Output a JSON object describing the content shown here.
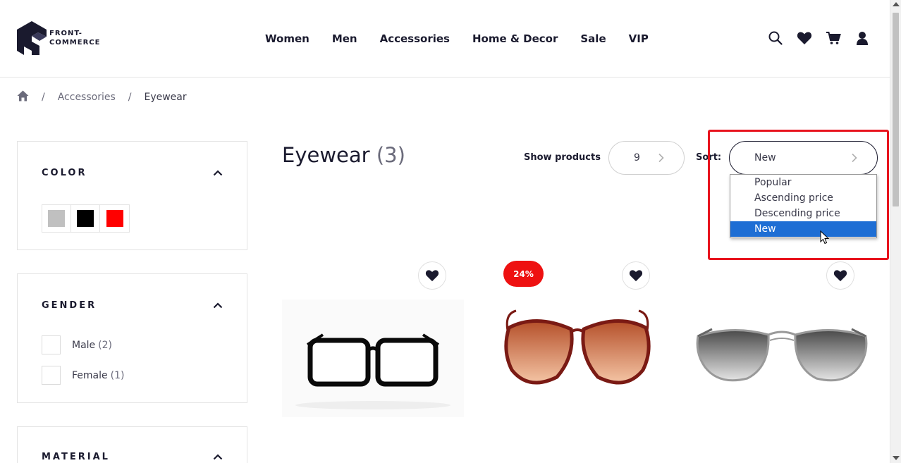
{
  "brand": {
    "line1": "FRONT-",
    "line2": "COMMERCE"
  },
  "nav": [
    {
      "label": "Women"
    },
    {
      "label": "Men"
    },
    {
      "label": "Accessories"
    },
    {
      "label": "Home & Decor"
    },
    {
      "label": "Sale"
    },
    {
      "label": "VIP"
    }
  ],
  "header_icons": [
    "search-icon",
    "heart-icon",
    "cart-icon",
    "user-icon"
  ],
  "breadcrumb": {
    "home_icon": "home-icon",
    "sep": "/",
    "parent": "Accessories",
    "current": "Eyewear"
  },
  "filters": {
    "color": {
      "title": "COLOR",
      "swatches": [
        "#c0c0c0",
        "#000000",
        "#ff0000"
      ]
    },
    "gender": {
      "title": "GENDER",
      "options": [
        {
          "label": "Male",
          "count": "(2)"
        },
        {
          "label": "Female",
          "count": "(1)"
        }
      ]
    },
    "material": {
      "title": "MATERIAL"
    }
  },
  "listing": {
    "title": "Eyewear",
    "count": "(3)",
    "show_label": "Show products",
    "per_page": "9",
    "sort_label": "Sort:",
    "sort_value": "New",
    "sort_options": [
      "Popular",
      "Ascending price",
      "Descending price",
      "New"
    ],
    "sort_selected": "New"
  },
  "products": [
    {
      "badge": "",
      "image": "black-frame-glasses"
    },
    {
      "badge": "24%",
      "image": "brown-oversized-sunglasses"
    },
    {
      "badge": "",
      "image": "aviator-sunglasses"
    }
  ],
  "colors": {
    "accent": "#1a1a2e",
    "sale": "#ee1111",
    "selected_option": "#1e6ed4",
    "annotation": "#e8141e"
  }
}
